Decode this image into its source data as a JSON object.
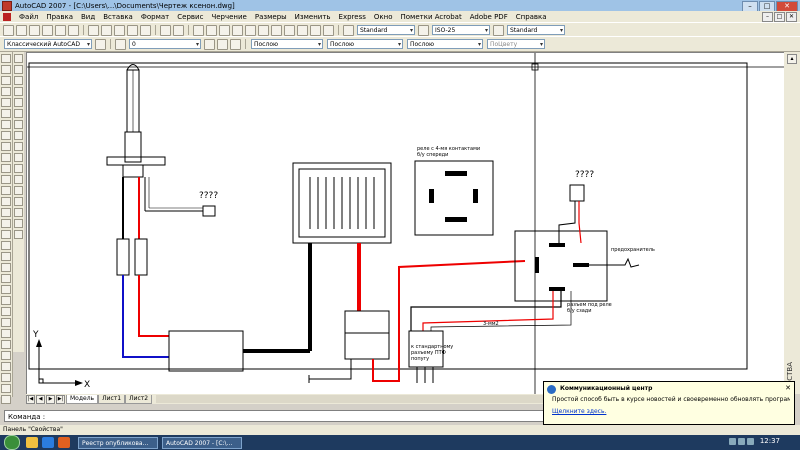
{
  "window": {
    "title": "AutoCAD 2007 - [C:\\Users\\...\\Documents\\Чертеж ксенон.dwg]",
    "controls": [
      "–",
      "□",
      "✕"
    ]
  },
  "menu": {
    "items": [
      "Файл",
      "Правка",
      "Вид",
      "Вставка",
      "Формат",
      "Сервис",
      "Черчение",
      "Размеры",
      "Изменить",
      "Express",
      "Окно",
      "Пометки Acrobat",
      "Adobe PDF",
      "Справка"
    ],
    "mdi_controls": [
      "–",
      "□",
      "✕"
    ]
  },
  "toolbar1": {
    "text_style": "Standard",
    "dim_style": "ISO-25",
    "table_style": "Standard"
  },
  "toolbar2": {
    "workspace": "Классический AutoCAD",
    "layer": "0",
    "color": "Послою",
    "linetype": "Послою",
    "lineweight": "Послою",
    "plotstyle": "ПоЦвету"
  },
  "drawing": {
    "labels": {
      "q1": "????",
      "q2": "????",
      "relay_title_1": "реле с 4-мя контактами",
      "relay_title_2": "б/у спереди",
      "plug_1": "к стандартному",
      "plug_2": "разъему ПТФ",
      "plug_3": "попугу",
      "connector_1": "разъем под реле",
      "connector_2": "б/у сзади",
      "fuse": "предохранитель",
      "wire": "3-мм2"
    },
    "ucs": {
      "x": "X",
      "y": "Y"
    }
  },
  "layout_tabs": {
    "nav": [
      "|◀",
      "◀",
      "▶",
      "▶|"
    ],
    "tabs": [
      "Модель",
      "Лист1",
      "Лист2"
    ]
  },
  "command_line": {
    "prompt": "Команда :"
  },
  "status_bar": {
    "text": "Панель \"Свойства\""
  },
  "properties_panel": {
    "label": "СВОЙСТВА"
  },
  "balloon": {
    "title": "Коммуникационный центр",
    "body": "Простой способ быть в курсе новостей и своевременно обновлять программное обеспечение",
    "link": "Щелкните здесь."
  },
  "taskbar": {
    "tasks": [
      "Реестр опубликова...",
      "AutoCAD 2007 - [C:\\..."
    ],
    "clock": "12:37"
  }
}
